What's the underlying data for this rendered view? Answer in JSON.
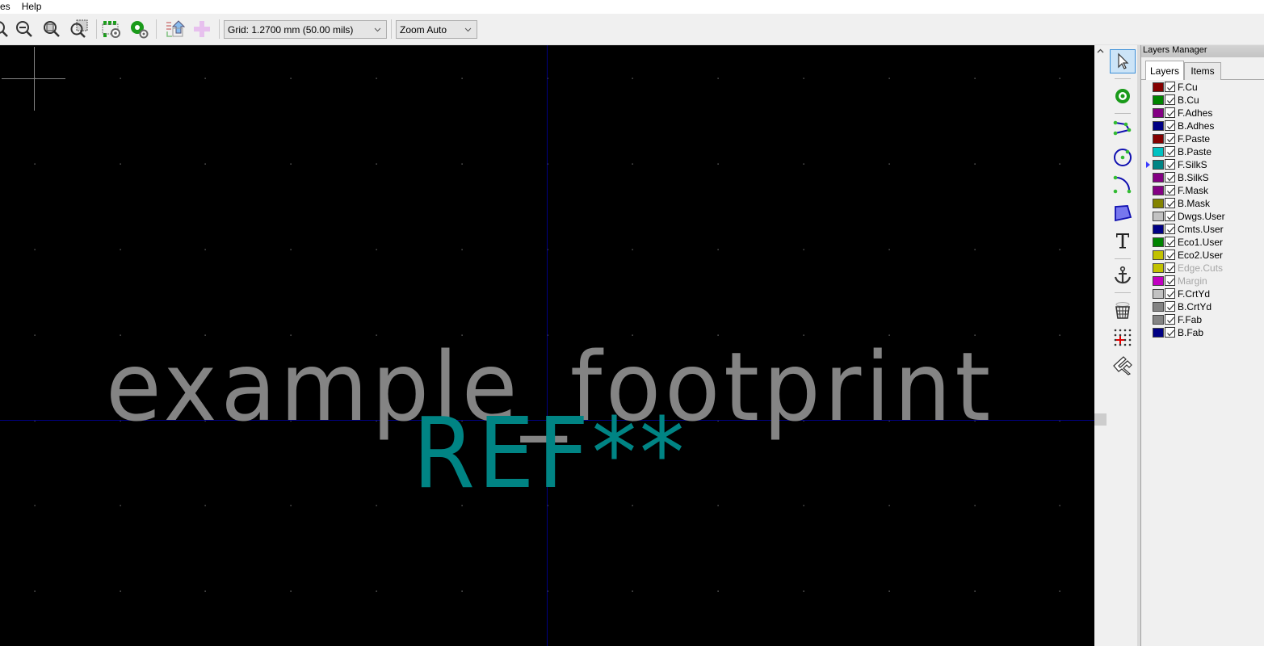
{
  "menubar": {
    "items": [
      "ces",
      "Help"
    ]
  },
  "toolbar": {
    "buttons": [
      {
        "name": "zoom-in",
        "icon": "zoom-in-icon"
      },
      {
        "name": "zoom-out",
        "icon": "zoom-out-icon"
      },
      {
        "name": "zoom-fit",
        "icon": "zoom-fit-icon"
      },
      {
        "name": "zoom-selection",
        "icon": "zoom-selection-icon"
      },
      {
        "name": "footprint-properties",
        "icon": "footprint-settings-icon"
      },
      {
        "name": "pad-settings",
        "icon": "pad-settings-icon"
      },
      {
        "name": "load-from-board",
        "icon": "update-from-board-icon"
      },
      {
        "name": "insert-into-board",
        "icon": "insert-plus-icon"
      }
    ],
    "grid_select": "Grid: 1.2700 mm (50.00 mils)",
    "zoom_select": "Zoom Auto"
  },
  "canvas": {
    "footprint_value_text": "example_footprint",
    "reference_text": "REF**",
    "colors": {
      "background": "#000000",
      "value_text": "#848484",
      "reference_text": "#008484",
      "axis": "#000084",
      "grid_dot": "#848484",
      "cursor": "#848484"
    }
  },
  "vtoolbar": {
    "tools": [
      {
        "name": "select",
        "icon": "cursor-arrow-icon",
        "active": true
      },
      {
        "name": "add-pad",
        "icon": "pad-icon"
      },
      {
        "name": "add-line",
        "icon": "polyline-icon"
      },
      {
        "name": "add-circle",
        "icon": "circle-icon"
      },
      {
        "name": "add-arc",
        "icon": "arc-icon"
      },
      {
        "name": "add-polygon",
        "icon": "polygon-icon"
      },
      {
        "name": "add-text",
        "icon": "text-icon"
      },
      {
        "name": "set-anchor",
        "icon": "anchor-icon"
      },
      {
        "name": "delete",
        "icon": "trash-icon"
      },
      {
        "name": "grid-origin",
        "icon": "grid-origin-icon"
      },
      {
        "name": "measure",
        "icon": "caliper-icon"
      }
    ]
  },
  "layers_manager": {
    "title": "Layers Manager",
    "tabs": [
      {
        "label": "Layers",
        "selected": true
      },
      {
        "label": "Items",
        "selected": false
      }
    ],
    "layers": [
      {
        "name": "F.Cu",
        "color": "#840000",
        "checked": true,
        "enabled": true,
        "current": false
      },
      {
        "name": "B.Cu",
        "color": "#008400",
        "checked": true,
        "enabled": true,
        "current": false
      },
      {
        "name": "F.Adhes",
        "color": "#840084",
        "checked": true,
        "enabled": true,
        "current": false
      },
      {
        "name": "B.Adhes",
        "color": "#000084",
        "checked": true,
        "enabled": true,
        "current": false
      },
      {
        "name": "F.Paste",
        "color": "#840000",
        "checked": true,
        "enabled": true,
        "current": false
      },
      {
        "name": "B.Paste",
        "color": "#00c2c2",
        "checked": true,
        "enabled": true,
        "current": false
      },
      {
        "name": "F.SilkS",
        "color": "#008484",
        "checked": true,
        "enabled": true,
        "current": true
      },
      {
        "name": "B.SilkS",
        "color": "#840084",
        "checked": true,
        "enabled": true,
        "current": false
      },
      {
        "name": "F.Mask",
        "color": "#840084",
        "checked": true,
        "enabled": true,
        "current": false
      },
      {
        "name": "B.Mask",
        "color": "#848400",
        "checked": true,
        "enabled": true,
        "current": false
      },
      {
        "name": "Dwgs.User",
        "color": "#c2c2c2",
        "checked": true,
        "enabled": true,
        "current": false
      },
      {
        "name": "Cmts.User",
        "color": "#000084",
        "checked": true,
        "enabled": true,
        "current": false
      },
      {
        "name": "Eco1.User",
        "color": "#008400",
        "checked": true,
        "enabled": true,
        "current": false
      },
      {
        "name": "Eco2.User",
        "color": "#c2c200",
        "checked": true,
        "enabled": true,
        "current": false
      },
      {
        "name": "Edge.Cuts",
        "color": "#c2c200",
        "checked": true,
        "enabled": false,
        "current": false
      },
      {
        "name": "Margin",
        "color": "#c200c2",
        "checked": true,
        "enabled": false,
        "current": false
      },
      {
        "name": "F.CrtYd",
        "color": "#c2c2c2",
        "checked": true,
        "enabled": true,
        "current": false
      },
      {
        "name": "B.CrtYd",
        "color": "#848484",
        "checked": true,
        "enabled": true,
        "current": false
      },
      {
        "name": "F.Fab",
        "color": "#848484",
        "checked": true,
        "enabled": true,
        "current": false
      },
      {
        "name": "B.Fab",
        "color": "#000084",
        "checked": true,
        "enabled": true,
        "current": false
      }
    ]
  }
}
